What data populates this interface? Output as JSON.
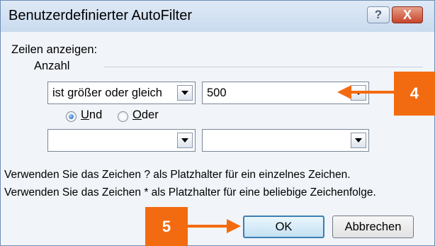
{
  "dialog": {
    "title": "Benutzerdefinierter AutoFilter",
    "help_label": "?",
    "close_label": "X"
  },
  "content": {
    "show_rows_label": "Zeilen anzeigen:",
    "field_label": "Anzahl",
    "row1": {
      "operator": "ist größer oder gleich",
      "value": "500"
    },
    "logic": {
      "and_key": "U",
      "and_rest": "nd",
      "or_key": "O",
      "or_rest": "der",
      "selected": "Und"
    },
    "row2": {
      "operator": "",
      "value": ""
    },
    "hint1": "Verwenden Sie das Zeichen ? als Platzhalter für ein einzelnes Zeichen.",
    "hint2": "Verwenden Sie das Zeichen * als Platzhalter für eine beliebige Zeichenfolge."
  },
  "buttons": {
    "ok": "OK",
    "cancel": "Abbrechen"
  },
  "annotations": {
    "step4": "4",
    "step5": "5",
    "color": "#f36b10"
  }
}
